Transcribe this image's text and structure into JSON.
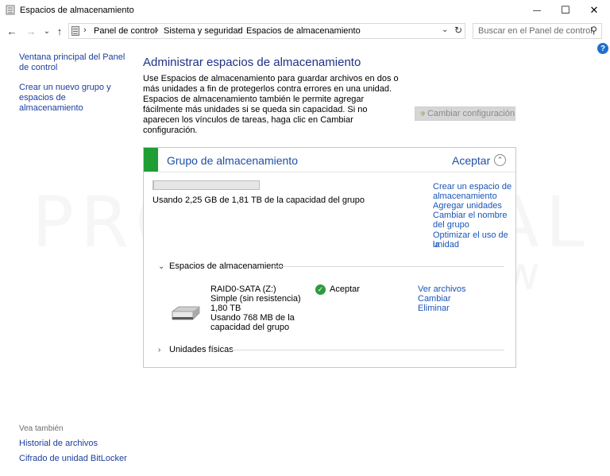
{
  "window": {
    "title": "Espacios de almacenamiento",
    "minimize_glyph": "—",
    "maximize_glyph": "☐",
    "close_glyph": "✕"
  },
  "nav": {
    "back_glyph": "←",
    "forward_glyph": "→",
    "recent_glyph": "⌄",
    "up_glyph": "↑",
    "breadcrumbs": [
      "Panel de control",
      "Sistema y seguridad",
      "Espacios de almacenamiento"
    ],
    "separator": "›",
    "dropdown_glyph": "⌄",
    "refresh_glyph": "↻",
    "search_placeholder": "Buscar en el Panel de control",
    "search_glyph": "⚲"
  },
  "sidebar": {
    "links": [
      {
        "label": "Ventana principal del Panel de control"
      },
      {
        "label": "Crear un nuevo grupo y espacios de almacenamiento"
      }
    ],
    "see_also_label": "Vea también",
    "see_also": [
      {
        "label": "Historial de archivos"
      },
      {
        "label": "Cifrado de unidad BitLocker"
      }
    ]
  },
  "help_glyph": "?",
  "main": {
    "title": "Administrar espacios de almacenamiento",
    "description": "Use Espacios de almacenamiento para guardar archivos en dos o más unidades a fin de protegerlos contra errores en una unidad. Espacios de almacenamiento también le permite agregar fácilmente más unidades si se queda sin capacidad. Si no aparecen los vínculos de tareas, haga clic en Cambiar configuración.",
    "change_settings_label": "Cambiar configuración"
  },
  "pool": {
    "name": "Grupo de almacenamiento",
    "status": "Aceptar",
    "collapse_glyph": "⌃",
    "usage_fraction": 0.0012,
    "usage_text": "Usando 2,25 GB de 1,81 TB de la capacidad del grupo",
    "links": [
      {
        "label": "Crear un espacio de"
      },
      {
        "label": "almacenamiento"
      },
      {
        "label": "Agregar unidades"
      },
      {
        "label": "Cambiar el nombre"
      },
      {
        "label": "del grupo"
      },
      {
        "label": "Optimizar el uso de la"
      },
      {
        "label": "unidad"
      }
    ],
    "spaces_section": {
      "chevron": "⌄",
      "label": "Espacios de almacenamiento"
    },
    "space": {
      "name": "RAID0-SATA (Z:)",
      "type": "Simple (sin resistencia)",
      "size": "1,80 TB",
      "usage_line1": "Usando 768 MB de la",
      "usage_line2": "capacidad del grupo",
      "status": "Aceptar",
      "status_glyph": "✓",
      "links": [
        {
          "label": "Ver archivos"
        },
        {
          "label": "Cambiar"
        },
        {
          "label": "Eliminar"
        }
      ]
    },
    "physical_section": {
      "chevron": "›",
      "label": "Unidades físicas"
    }
  },
  "watermark": {
    "line1": "PROFESIONAL",
    "line2": "review"
  },
  "colors": {
    "link": "#1a55b8",
    "heading": "#1e3287",
    "status_green": "#1e9e33"
  }
}
